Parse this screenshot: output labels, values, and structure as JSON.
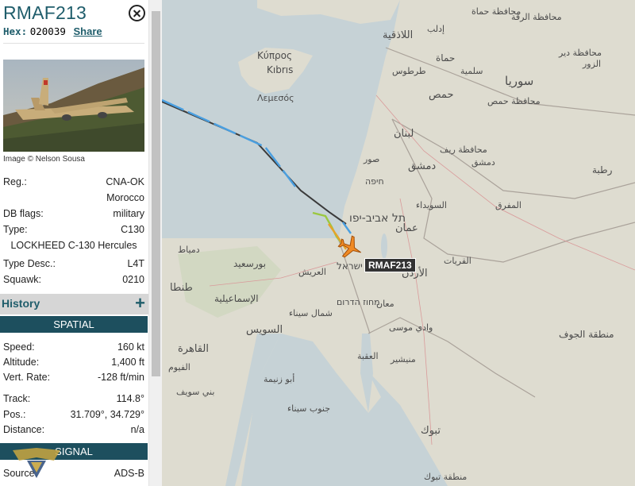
{
  "aircraft": {
    "callsign": "RMAF213",
    "hex_label": "Hex:",
    "hex_value": "020039",
    "share_label": "Share",
    "photo_credit": "Image © Nelson Sousa"
  },
  "details": {
    "reg_label": "Reg.:",
    "reg_value": "CNA-OK",
    "country": "Morocco",
    "db_flags_label": "DB flags:",
    "db_flags_value": "military",
    "type_label": "Type:",
    "type_value": "C130",
    "type_full": "LOCKHEED C-130 Hercules",
    "type_desc_label": "Type Desc.:",
    "type_desc_value": "L4T",
    "squawk_label": "Squawk:",
    "squawk_value": "0210"
  },
  "history": {
    "title": "History",
    "expand_icon": "plus-icon"
  },
  "spatial": {
    "header": "SPATIAL",
    "speed_label": "Speed:",
    "speed_value": "160 kt",
    "altitude_label": "Altitude:",
    "altitude_value": "1,400 ft",
    "vert_rate_label": "Vert. Rate:",
    "vert_rate_value": "-128 ft/min",
    "track_label": "Track:",
    "track_value": "114.8°",
    "pos_label": "Pos.:",
    "pos_value": "31.709°, 34.729°",
    "distance_label": "Distance:",
    "distance_value": "n/a"
  },
  "signal": {
    "header": "SIGNAL",
    "source_label": "Source:",
    "source_value": "ADS-B"
  },
  "map": {
    "aircraft_label": "RMAF213",
    "labels": {
      "cyprus": "Κύπρος",
      "kibris": "Kıbrıs",
      "lemesos": "Λεμεσός",
      "idlib": "إدلب",
      "latakia": "اللاذقية",
      "hama_gov": "محافظة حماة",
      "hama": "حماة",
      "tartus": "طرطوس",
      "salamiyah": "سلمية",
      "syria": "سوريا",
      "raqqa": "محافظة الرقة",
      "dayr_gov": "محافظة دير",
      "zor": "الزور",
      "homs": "حمص",
      "homs_gov": "محافظة حمص",
      "lebanon": "لبنان",
      "rif_gov": "محافظة ريف",
      "dimashq": "دمشق",
      "tyre": "صور",
      "damascus": "دمشق",
      "rutba": "رطبة",
      "haifa": "חיפה",
      "suwayda": "السويداء",
      "mafraq": "المفرق",
      "tel_aviv": "תל אביב-יפו",
      "amman": "عمان",
      "port_said": "بورسعيد",
      "qurayyat": "القريات",
      "damietta": "دمياط",
      "tanta": "طنطا",
      "israel": "ישראל",
      "jordan": "الأردن",
      "arish": "العريش",
      "ismailia": "الإسماعيلية",
      "north_sinai": "شمال سيناء",
      "negev": "מחוז הדרום",
      "maan": "معان",
      "wadi_musa": "وادي موسى",
      "jawf": "منطقة الجوف",
      "cairo": "القاهرة",
      "suez": "السويس",
      "aqaba": "العقبة",
      "fayoum": "الفيوم",
      "muwaylih": "منيشير",
      "abu_zenima": "أبو زنيمة",
      "beni_suef": "بني سويف",
      "south_sinai": "جنوب سيناء",
      "tabuk": "تبوك",
      "tabuk_region": "منطقة تبوك"
    }
  },
  "colors": {
    "accent": "#1f5d6b",
    "section_header": "#1d4f5e",
    "track_blue": "#4a9fe0",
    "aircraft": "#f08a24"
  }
}
